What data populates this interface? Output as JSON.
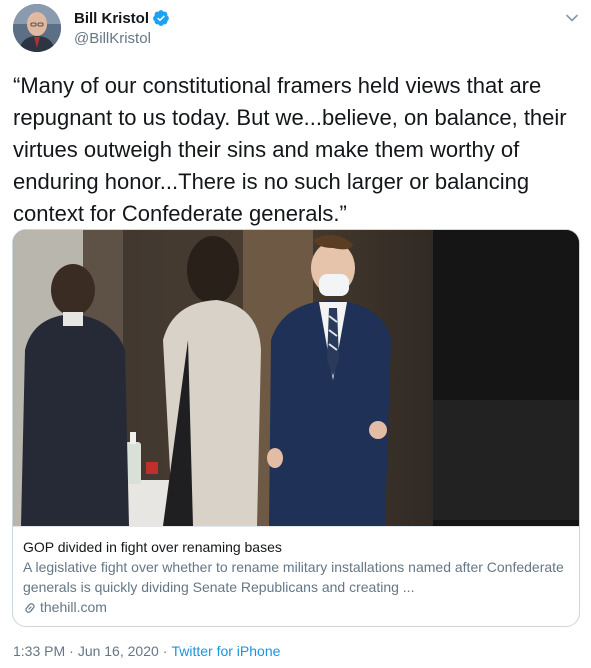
{
  "author": {
    "display_name": "Bill Kristol",
    "handle": "@BillKristol",
    "verified": true,
    "avatar_icon": "profile-photo"
  },
  "menu_icon": "chevron-down-icon",
  "tweet": {
    "text": "“Many of our constitutional framers held views that are repugnant to us today. But we...believe, on balance, their virtues outweigh their sins and make them worthy of enduring honor...There is no such larger or balancing context for Confederate generals.”"
  },
  "card": {
    "title": "GOP divided in fight over renaming bases",
    "description": "A legislative fight over whether to rename military installations named after Confederate generals is quickly dividing Senate Republicans and creating ...",
    "domain": "thehill.com",
    "link_icon": "link-icon"
  },
  "meta": {
    "time": "1:33 PM",
    "separator": "·",
    "date": "Jun 16, 2020",
    "source": "Twitter for iPhone"
  },
  "colors": {
    "accent": "#1da1f2",
    "link": "#1b95e0",
    "secondary_text": "#657786",
    "border": "#ccd6dd"
  }
}
